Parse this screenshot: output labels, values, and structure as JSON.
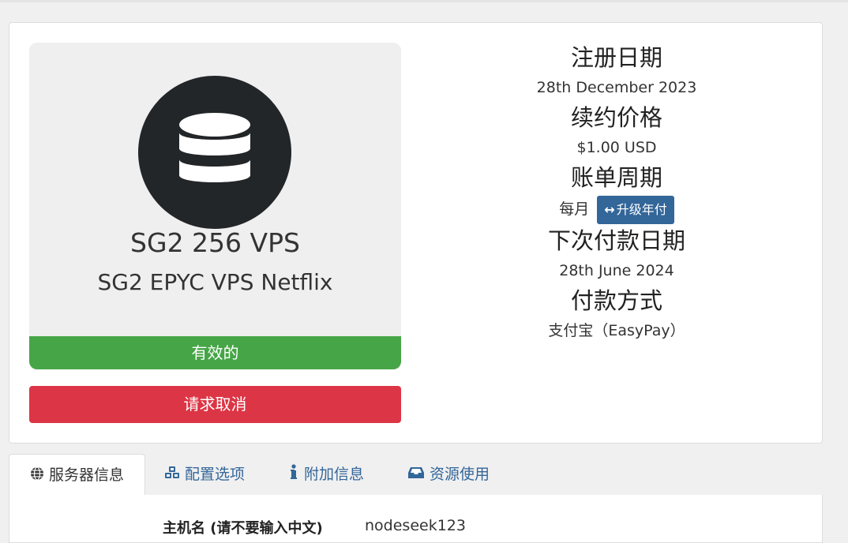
{
  "product": {
    "icon": "database-icon",
    "name": "SG2 256 VPS",
    "group": "SG2 EPYC VPS Netflix",
    "status": "有效的",
    "status_color": "#46a546"
  },
  "actions": {
    "cancel_label": "请求取消",
    "cancel_color": "#dc3545"
  },
  "details": {
    "registration_date_label": "注册日期",
    "registration_date": "28th December 2023",
    "renewal_price_label": "续约价格",
    "renewal_price": "$1.00 USD",
    "billing_cycle_label": "账单周期",
    "billing_cycle": "每月",
    "upgrade_label": "升级年付",
    "upgrade_icon": "arrows-h-icon",
    "next_due_label": "下次付款日期",
    "next_due_date": "28th June 2024",
    "payment_method_label": "付款方式",
    "payment_method": "支付宝（EasyPay）"
  },
  "tabs": [
    {
      "label": "服务器信息",
      "icon": "globe-icon",
      "active": true
    },
    {
      "label": "配置选项",
      "icon": "cubes-icon",
      "active": false
    },
    {
      "label": "附加信息",
      "icon": "info-icon",
      "active": false
    },
    {
      "label": "资源使用",
      "icon": "inbox-icon",
      "active": false
    }
  ],
  "server_info": {
    "hostname_label": "主机名 (请不要输入中文)",
    "hostname": "nodeseek123"
  },
  "colors": {
    "accent": "#336699"
  }
}
